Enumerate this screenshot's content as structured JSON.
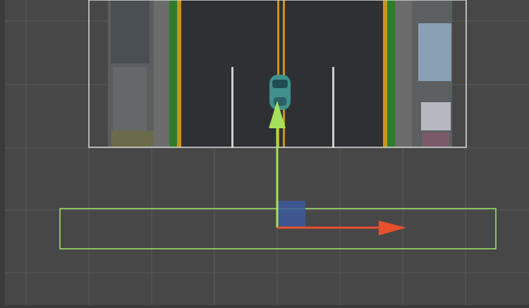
{
  "editor": {
    "view": "scene-view",
    "mode": "2D",
    "grid": true,
    "selected_object": "collider-box",
    "background_color": "#474747",
    "grid_color": "#5a5a5a"
  },
  "scene": {
    "road_sprite": {
      "road_color": "#2f3033",
      "center_line_color": "#c9951c",
      "edge_line_color": "#c89418",
      "lane_dash_color": "#cfcfcf",
      "grass_color": "#2f7c2a",
      "sidewalk_color": "#6c6c6c"
    },
    "vehicle": {
      "name": "car",
      "color": "#3f8f8c"
    },
    "collider": {
      "shape": "box",
      "color": "#9ee86a"
    }
  },
  "gizmos": {
    "move_tool": {
      "x_axis_color": "#e8502e",
      "y_axis_color": "#a7e05a",
      "plane_handle_color": "#3e5a9e"
    }
  }
}
